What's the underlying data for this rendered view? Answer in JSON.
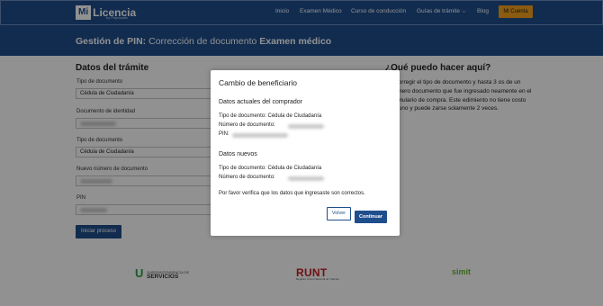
{
  "header": {
    "logo_mark": "Mi",
    "logo_text": "Licencia",
    "logo_sub": "by Paynopain",
    "nav": [
      "Inicio",
      "Examen Médico",
      "Curso de conducción",
      "Guías de trámite",
      "Blog"
    ],
    "cta": "Mi Cuenta",
    "accent": "#1f4e8c",
    "cta_color": "#f3a11d"
  },
  "title": {
    "prefix": "Gestión de PIN:",
    "middle": " Corrección de documento ",
    "suffix": "Examen médico"
  },
  "form": {
    "heading": "Datos del trámite",
    "fields": [
      {
        "label": "Tipo de documento",
        "value": "Cédula de Ciudadanía"
      },
      {
        "label": "Documento de identidad",
        "value": ""
      },
      {
        "label": "Tipo de documento",
        "value": "Cédula de Ciudadanía"
      },
      {
        "label": "Nuevo número de documento",
        "value": ""
      },
      {
        "label": "PIN",
        "value": ""
      }
    ],
    "submit": "Iniciar proceso"
  },
  "help": {
    "heading": "¿Qué puedo hacer aquí?",
    "text": "e corregir el tipo de documento y hasta 3 os de un número documento que fue ingresado neamente en el formulario de compra. Este edimiento no tiene costo alguno y puede zarse solamente 2 veces."
  },
  "footer": {
    "svc_mark": "U",
    "svc_small": "SUPERINTENDENCIA DE",
    "svc_big": "SERVICIOS",
    "runt": "RUNT",
    "runt_sub": "Registro Único Nacional de Tránsito",
    "simit": "simit"
  },
  "modal": {
    "title": "Cambio de beneficiario",
    "current_heading": "Datos actuales del comprador",
    "current": {
      "tipo_label": "Tipo de documento:",
      "tipo_value": "Cédula de Ciudadanía",
      "numero_label": "Número de documento:",
      "pin_label": "PIN:"
    },
    "new_heading": "Datos nuevos",
    "new": {
      "tipo_label": "Tipo de documento:",
      "tipo_value": "Cédula de Ciudadanía",
      "numero_label": "Número de documento:"
    },
    "note": "Por favor verifica que los datos que ingresaste son correctos.",
    "back": "Volver",
    "continue": "Continuar"
  }
}
